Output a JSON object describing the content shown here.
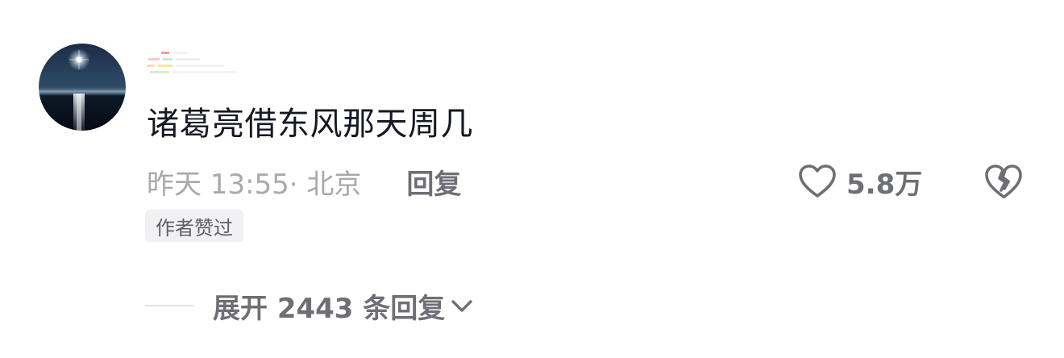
{
  "comment": {
    "avatar_icon": "night-sea-moon-avatar",
    "text": "诸葛亮借东风那天周几",
    "time_location": "昨天 13:55· 北京",
    "reply_label": "回复",
    "like_count": "5.8万",
    "like_icon": "heart-outline-icon",
    "dislike_icon": "broken-heart-icon",
    "author_badge": "作者赞过"
  },
  "expand": {
    "label": "展开 2443 条回复",
    "icon": "chevron-down-icon"
  },
  "colors": {
    "text_primary": "#161823",
    "text_secondary": "#6e6f74",
    "text_muted": "#a8a8ad",
    "badge_bg": "#f1f1f3"
  }
}
